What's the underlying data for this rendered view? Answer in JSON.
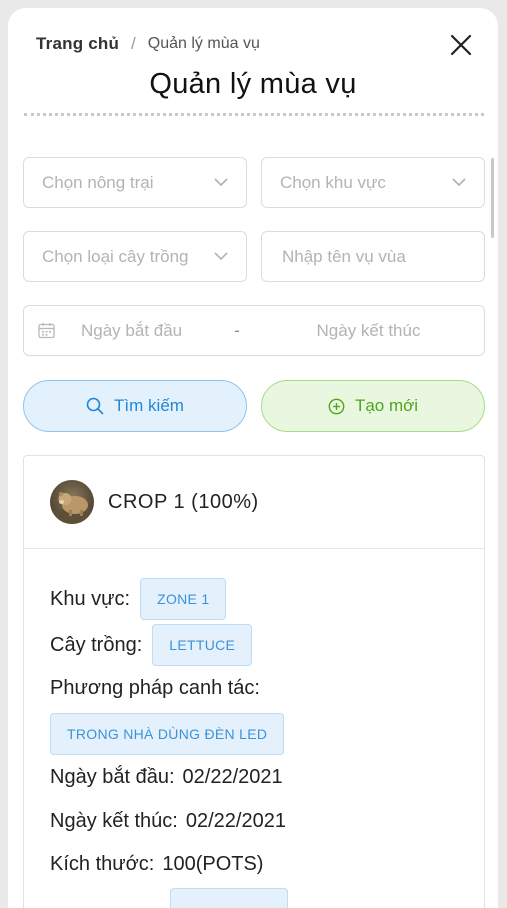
{
  "breadcrumb": {
    "home": "Trang chủ",
    "separator": "/",
    "current": "Quản lý mùa vụ"
  },
  "title": "Quản lý mùa vụ",
  "filters": {
    "farm_placeholder": "Chọn nông trại",
    "zone_placeholder": "Chọn khu vực",
    "crop_type_placeholder": "Chọn loại cây trồng",
    "season_name_placeholder": "Nhập tên vụ vùa",
    "start_date_placeholder": "Ngày bắt đầu",
    "date_separator": "-",
    "end_date_placeholder": "Ngày kết thúc"
  },
  "actions": {
    "search_label": "Tìm kiếm",
    "create_label": "Tạo mới"
  },
  "crop_card": {
    "title": "CROP 1 (100%)",
    "zone_label": "Khu vực:",
    "zone_value": "ZONE 1",
    "crop_label": "Cây trồng:",
    "crop_value": "LETTUCE",
    "method_label": "Phương pháp canh tác:",
    "method_value": "TRONG NHÀ DÙNG ĐÈN LED",
    "start_date_label": "Ngày bắt đầu:",
    "start_date_value": "02/22/2021",
    "end_date_label": "Ngày kết thúc:",
    "end_date_value": "02/22/2021",
    "size_label": "Kích thước:",
    "size_value": "100(POTS)"
  },
  "colors": {
    "search_blue": "#1f86d8",
    "create_green": "#4fa61c",
    "tag_blue": "#3a93d8"
  }
}
